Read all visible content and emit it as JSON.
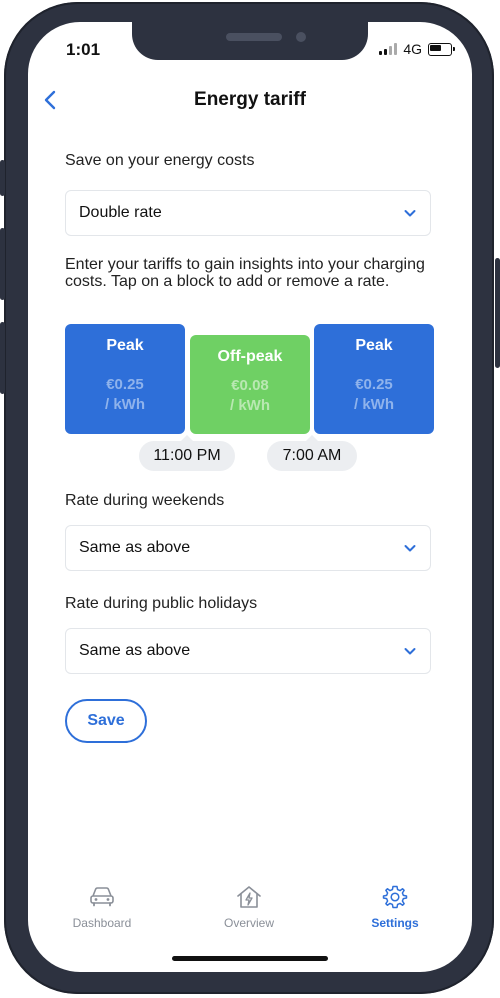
{
  "status": {
    "time": "1:01",
    "network": "4G"
  },
  "header": {
    "title": "Energy tariff"
  },
  "tariff": {
    "label": "Save on your energy costs",
    "selected": "Double rate",
    "instructions": "Enter your tariffs to gain insights into your charging costs. Tap on a block to add or remove a rate.",
    "blocks": [
      {
        "name": "Peak",
        "price": "€0.25",
        "unit": "/ kWh"
      },
      {
        "name": "Off-peak",
        "price": "€0.08",
        "unit": "/ kWh"
      },
      {
        "name": "Peak",
        "price": "€0.25",
        "unit": "/ kWh"
      }
    ],
    "times": [
      "11:00 PM",
      "7:00 AM"
    ]
  },
  "weekends": {
    "label": "Rate during weekends",
    "selected": "Same as above"
  },
  "holidays": {
    "label": "Rate during public holidays",
    "selected": "Same as above"
  },
  "save_label": "Save",
  "nav": {
    "items": [
      {
        "label": "Dashboard"
      },
      {
        "label": "Overview"
      },
      {
        "label": "Settings"
      }
    ]
  },
  "colors": {
    "accent": "#2e6fd9",
    "peak": "#2e6fd9",
    "offpeak": "#6fd064",
    "inactive": "#8a8f98"
  }
}
